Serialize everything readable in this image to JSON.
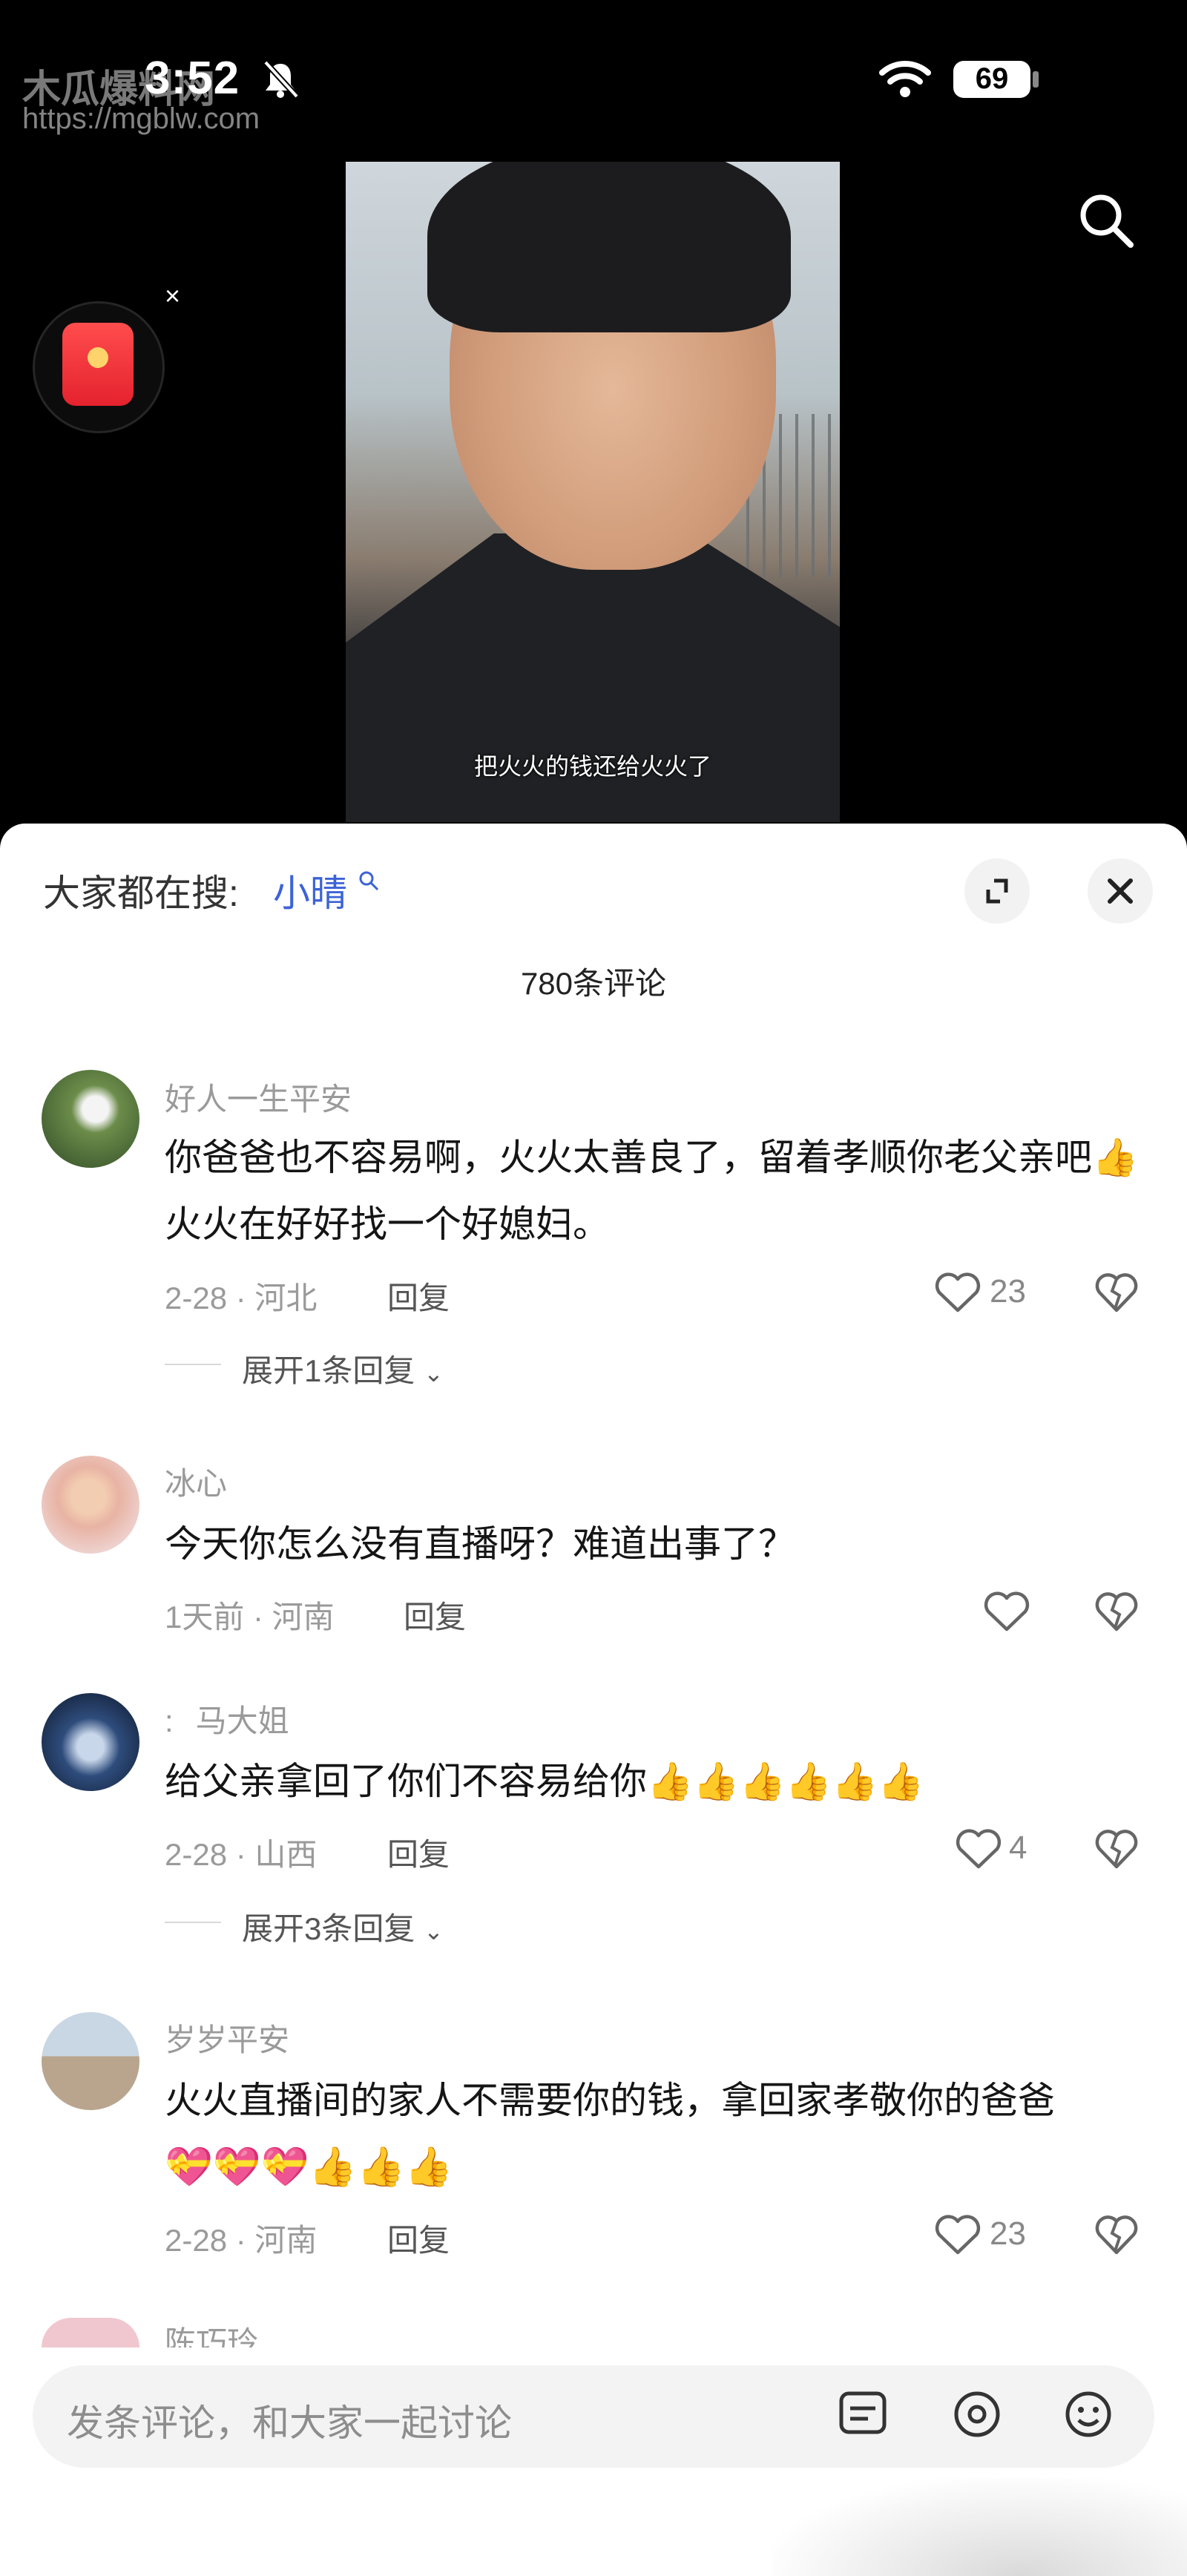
{
  "status_bar": {
    "time": "3:52",
    "battery": "69",
    "watermark_name": "木瓜爆料网",
    "watermark_url": "https://mgblw.com"
  },
  "video": {
    "subtitle": "把火火的钱还给火火了"
  },
  "comments_panel": {
    "hot_search_prefix": "大家都在搜:",
    "hot_search_term": "小晴",
    "count_label": "780条评论",
    "comments": [
      {
        "username": "好人一生平安",
        "text": "你爸爸也不容易啊，火火太善良了，留着孝顺你老父亲吧👍火火在好好找一个好媳妇。",
        "meta": "2-28 · 河北",
        "reply": "回复",
        "likes": "23",
        "expand": "展开1条回复"
      },
      {
        "username": "冰心",
        "text": "今天你怎么没有直播呀？难道出事了？",
        "meta": "1天前 · 河南",
        "reply": "回复",
        "likes": ""
      },
      {
        "username": "马大姐",
        "prefix": ":",
        "text": "给父亲拿回了你们不容易给你👍👍👍👍👍👍",
        "meta": "2-28 · 山西",
        "reply": "回复",
        "likes": "4",
        "expand": "展开3条回复"
      },
      {
        "username": "岁岁平安",
        "text": "火火直播间的家人不需要你的钱，拿回家孝敬你的爸爸",
        "emoji_line": "💝💝💝👍👍👍",
        "meta": "2-28 · 河南",
        "reply": "回复",
        "likes": "23"
      },
      {
        "username": "陈巧玲"
      }
    ]
  },
  "bottom_bar": {
    "placeholder": "发条评论，和大家一起讨论"
  }
}
